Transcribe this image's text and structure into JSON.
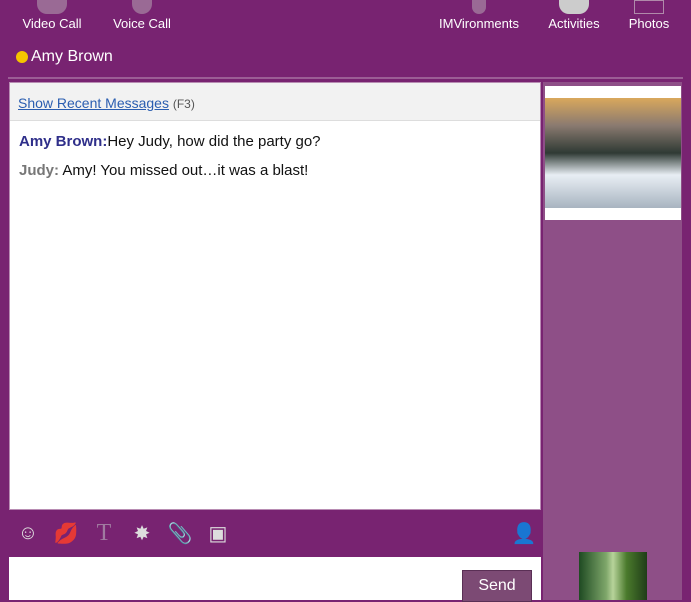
{
  "toolbar": {
    "video_call": "Video Call",
    "voice_call": "Voice Call",
    "imvironments": "IMVironments",
    "activities": "Activities",
    "photos": "Photos"
  },
  "contact": {
    "name": "Amy Brown",
    "status_color": "#f5c400"
  },
  "chat": {
    "show_recent": "Show Recent Messages",
    "shortcut": "(F3)",
    "messages": [
      {
        "sender": "Amy Brown:",
        "text": "Hey Judy, how did the party go?"
      },
      {
        "sender": "Judy:",
        "text": " Amy! You missed out…it was a blast!"
      }
    ]
  },
  "input": {
    "send_label": "Send"
  },
  "colors": {
    "background": "#782371",
    "side_panel": "#8e4f87"
  }
}
